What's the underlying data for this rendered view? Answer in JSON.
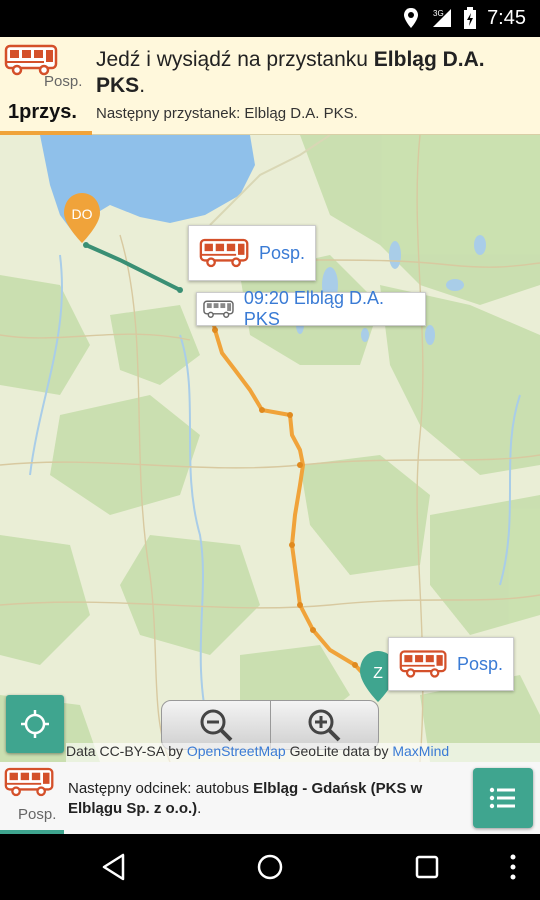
{
  "status_bar": {
    "time": "7:45",
    "icons": [
      "location-icon",
      "signal-3g-icon",
      "battery-icon"
    ]
  },
  "instruction": {
    "prefix": "Jedź i wysiądź na przystanku ",
    "stop_name": "Elbląg D.A. PKS",
    "suffix": ".",
    "vehicle_label": "Posp.",
    "stops_count": "1przys.",
    "next_stop": "Następny przystanek: Elbląg D.A. PKS."
  },
  "map": {
    "start_marker_label": "DO",
    "end_marker_label": "Z",
    "callout_top_label": "Posp.",
    "callout_time_label": "09:20 Elbląg D.A. PKS",
    "callout_bottom_label": "Posp.",
    "attribution_prefix": "Data CC-BY-SA by ",
    "attribution_osm": "OpenStreetMap",
    "attribution_mid": " GeoLite data by ",
    "attribution_maxmind": "MaxMind"
  },
  "bottom": {
    "vehicle_label": "Posp.",
    "segment_prefix": "Następny odcinek: autobus ",
    "segment_route": "Elbląg - Gdańsk (PKS w Elblągu Sp. z o.o.)",
    "segment_suffix": "."
  },
  "colors": {
    "accent_teal": "#3fa58f",
    "route_orange": "#f0a33a",
    "route_green": "#3a8f74",
    "link_blue": "#3a7bd5",
    "panel_bg": "#fff8dc"
  }
}
